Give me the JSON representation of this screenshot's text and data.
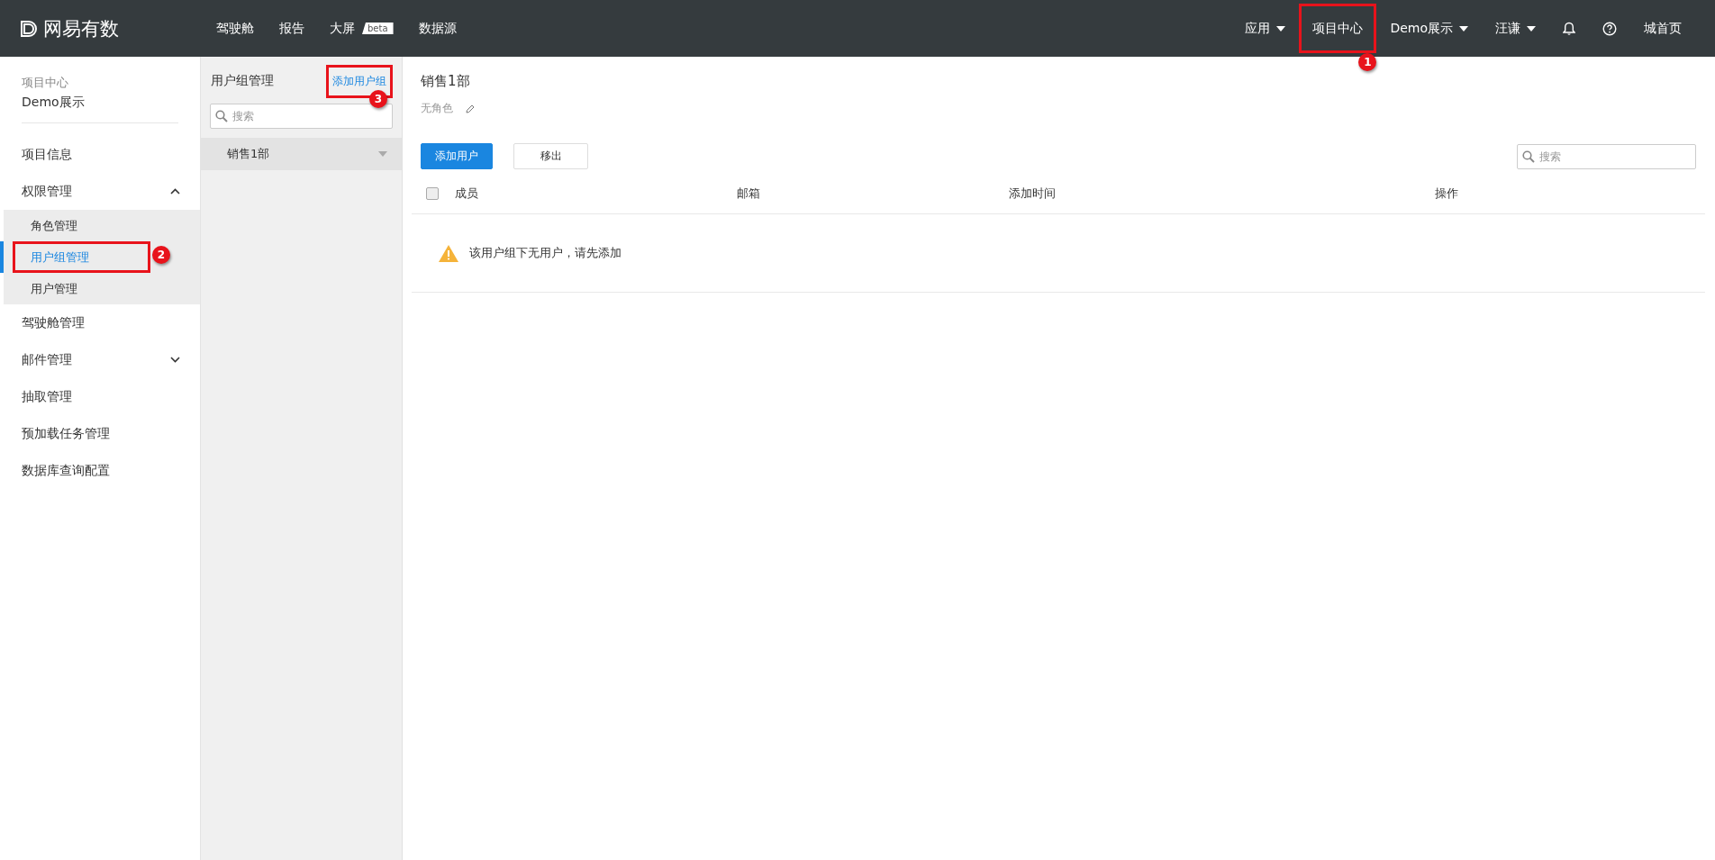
{
  "topbar": {
    "logo": "网易有数",
    "nav": [
      {
        "label": "驾驶舱"
      },
      {
        "label": "报告"
      },
      {
        "label": "大屏",
        "badge": "beta"
      },
      {
        "label": "数据源"
      }
    ],
    "right": [
      {
        "kind": "dropdown",
        "label": "应用"
      },
      {
        "kind": "link",
        "label": "项目中心",
        "callout": "1"
      },
      {
        "kind": "dropdown",
        "label": "Demo展示"
      },
      {
        "kind": "dropdown",
        "label": "汪谦"
      },
      {
        "kind": "bell"
      },
      {
        "kind": "help"
      },
      {
        "kind": "link",
        "label": "城首页"
      }
    ]
  },
  "sidebar": {
    "context": "项目中心",
    "project": "Demo展示",
    "items": [
      {
        "label": "项目信息",
        "selected": false
      },
      {
        "label": "权限管理",
        "selected": false,
        "expanded": true,
        "children": [
          {
            "label": "角色管理",
            "selected": false
          },
          {
            "label": "用户组管理",
            "selected": true,
            "callout": "2"
          },
          {
            "label": "用户管理",
            "selected": false
          }
        ]
      },
      {
        "label": "驾驶舱管理",
        "selected": false
      },
      {
        "label": "邮件管理",
        "selected": false,
        "expanded": false
      },
      {
        "label": "抽取管理",
        "selected": false
      },
      {
        "label": "预加载任务管理",
        "selected": false
      },
      {
        "label": "数据库查询配置",
        "selected": false
      }
    ]
  },
  "groups": {
    "title": "用户组管理",
    "add_link": {
      "label": "添加用户组",
      "callout": "3"
    },
    "search": {
      "placeholder": "搜索"
    },
    "items": [
      {
        "label": "销售1部",
        "selected": true
      }
    ]
  },
  "main": {
    "title": "销售1部",
    "role": "无角色",
    "buttons": [
      {
        "label": "添加用户",
        "kind": "primary"
      },
      {
        "label": "移出",
        "kind": "default"
      }
    ],
    "search": {
      "placeholder": "搜索"
    },
    "table": {
      "select_all_checked": false,
      "columns": [
        "成员",
        "邮箱",
        "添加时间",
        "操作"
      ],
      "empty_message": "该用户组下无用户，请先添加"
    }
  }
}
